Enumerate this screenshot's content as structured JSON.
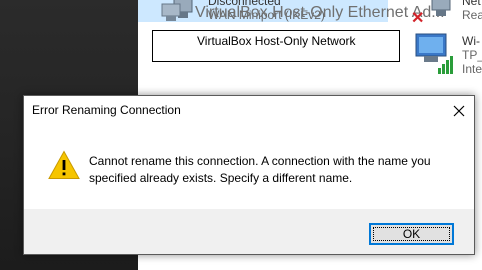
{
  "background_window": {
    "wan_item": {
      "line1": "Disconnected",
      "line2": "WAN Miniport (IKEv2)"
    },
    "rename_field": {
      "value": "VirtualBox Host-Only Network"
    },
    "vbox_item": {
      "label": "VirtualBox Host-Only Ethernet Ad..."
    },
    "right_item_1": {
      "line1": "Net",
      "line2": "Rea"
    },
    "wifi_item": {
      "line1": "Wi-",
      "line2": "TP_",
      "line3": "Inte"
    }
  },
  "dialog": {
    "title": "Error Renaming Connection",
    "message": "Cannot rename this connection. A connection with the name you specified already exists. Specify a different name.",
    "ok_label": "OK",
    "close_icon": "close-icon",
    "warning_icon": "warning-icon"
  },
  "colors": {
    "selection": "#cde8ff",
    "focus_border": "#0078d7",
    "footer_bg": "#f0f0f0",
    "warning_yellow": "#f6c500"
  }
}
